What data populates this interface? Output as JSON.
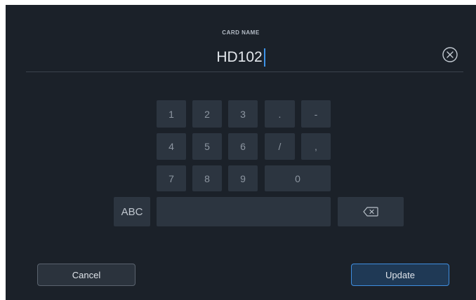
{
  "header": {
    "field_label": "CARD NAME",
    "field_value": "HD102",
    "clear_icon": "circle-x-icon"
  },
  "keypad": {
    "keys": {
      "k1": "1",
      "k2": "2",
      "k3": "3",
      "dot": ".",
      "dash": "-",
      "k4": "4",
      "k5": "5",
      "k6": "6",
      "slash": "/",
      "comma": ",",
      "k7": "7",
      "k8": "8",
      "k9": "9",
      "k0": "0",
      "abc": "ABC",
      "space": ""
    },
    "backspace_icon": "backspace-icon"
  },
  "footer": {
    "cancel_label": "Cancel",
    "update_label": "Update"
  },
  "colors": {
    "background": "#1b2129",
    "key": "#2c3540",
    "accent": "#3f8ee0"
  }
}
